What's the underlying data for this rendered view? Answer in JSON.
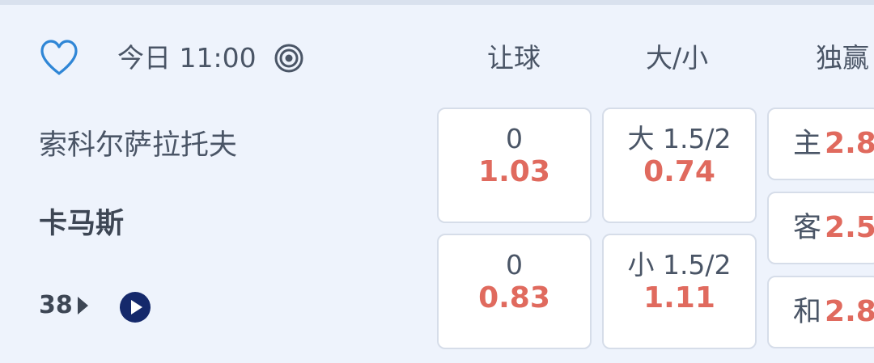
{
  "match": {
    "time": "今日 11:00",
    "home_team": "索科尔萨拉托夫",
    "away_team": "卡马斯",
    "more_markets_count": "38"
  },
  "columns": {
    "handicap": "让球",
    "over_under": "大/小",
    "moneyline": "独赢"
  },
  "handicap": [
    {
      "line": "0",
      "price": "1.03"
    },
    {
      "line": "0",
      "price": "0.83"
    }
  ],
  "over_under": [
    {
      "line": "大 1.5/2",
      "price": "0.74"
    },
    {
      "line": "小 1.5/2",
      "price": "1.11"
    }
  ],
  "moneyline": [
    {
      "label": "主",
      "price": "2.8"
    },
    {
      "label": "客",
      "price": "2.5"
    },
    {
      "label": "和",
      "price": "2.8"
    }
  ],
  "colors": {
    "background": "#eef3fc",
    "odds_price": "#e06a5e",
    "favorite_icon": "#2f86d6",
    "live_button": "#15296b"
  },
  "icons": {
    "favorite": "heart-outline-icon",
    "stats": "target-icon",
    "more": "caret-right-icon",
    "live": "play-circle-icon"
  }
}
